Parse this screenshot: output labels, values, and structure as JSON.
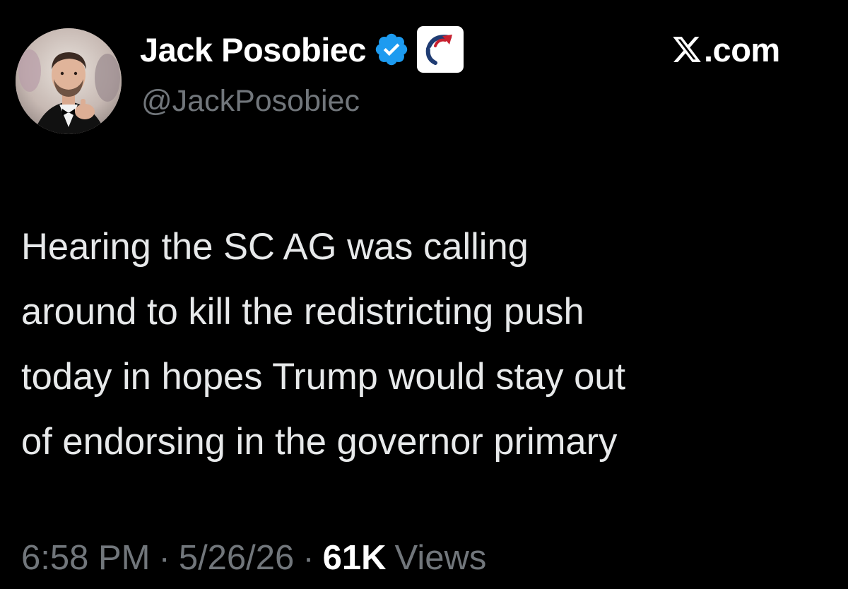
{
  "author": {
    "display_name": "Jack Posobiec",
    "handle": "@JackPosobiec",
    "verified_badge_icon": "verified-checkmark-icon",
    "affiliate_badge_icon": "affiliate-organization-badge-icon",
    "verified_color": "#1d9bf0"
  },
  "platform": {
    "logo_letter_icon": "x-logo-icon",
    "domain": ".com"
  },
  "tweet": {
    "lines": [
      "Hearing the SC AG was calling",
      "around to kill the redistricting push",
      "today in hopes Trump would stay out",
      "of endorsing in the governor primary"
    ]
  },
  "meta": {
    "time": "6:58 PM",
    "separator": "·",
    "date": "5/26/26",
    "views_count": "61K",
    "views_label": "Views"
  },
  "colors": {
    "background": "#000000",
    "primary_text": "#e7e9ea",
    "secondary_text": "#71767b",
    "name_text": "#ffffff"
  }
}
